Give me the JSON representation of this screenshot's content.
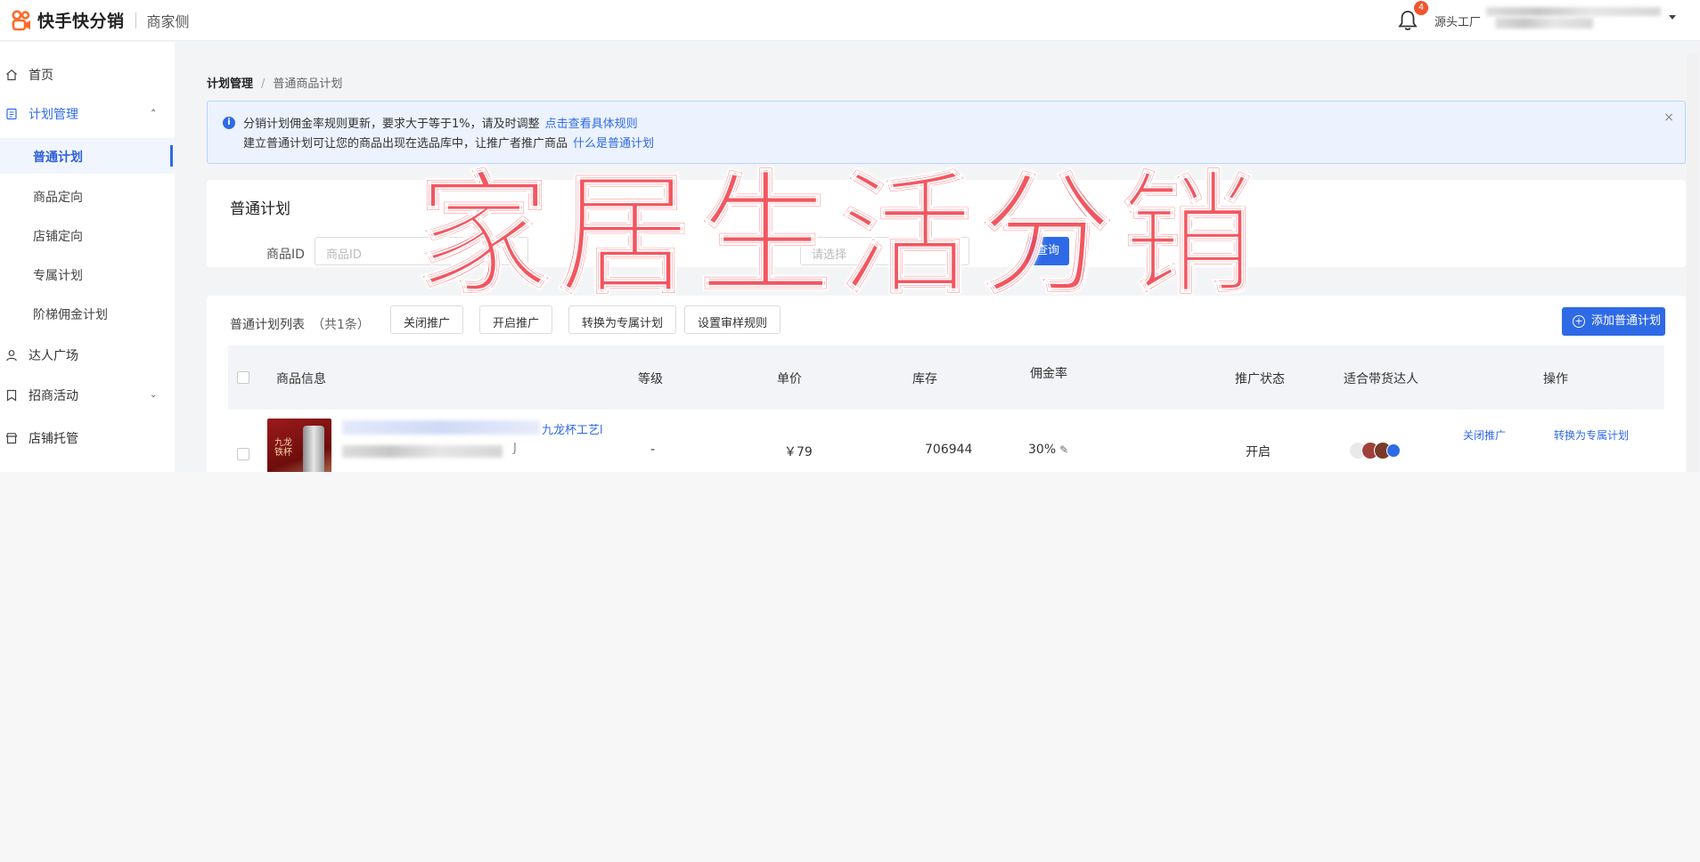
{
  "app": {
    "brand": "快手快分销",
    "subtitle": "商家侧"
  },
  "topbar": {
    "notification_count": "4",
    "user_name": "源头工厂"
  },
  "sidebar": {
    "items": [
      {
        "label": "首页",
        "icon": "home-icon"
      },
      {
        "label": "计划管理",
        "icon": "document-icon",
        "expanded": true
      },
      {
        "label": "达人广场",
        "icon": "user-icon"
      },
      {
        "label": "招商活动",
        "icon": "bookmark-icon",
        "expanded": false
      },
      {
        "label": "店铺托管",
        "icon": "store-icon"
      }
    ],
    "sub_items": [
      {
        "label": "普通计划",
        "active": true
      },
      {
        "label": "商品定向"
      },
      {
        "label": "店铺定向"
      },
      {
        "label": "专属计划"
      },
      {
        "label": "阶梯佣金计划"
      }
    ]
  },
  "breadcrumb": {
    "parent": "计划管理",
    "separator": "/",
    "current": "普通商品计划"
  },
  "alert": {
    "line1": "分销计划佣金率规则更新，要求大于等于1%，请及时调整",
    "line1_link": "点击查看具体规则",
    "line2": "建立普通计划可让您的商品出现在选品库中，让推广者推广商品",
    "line2_link": "什么是普通计划",
    "close": "×"
  },
  "filter": {
    "title": "普通计划",
    "product_id_label": "商品ID",
    "product_id_placeholder": "商品ID",
    "status_placeholder": "请选择",
    "search_button": "查询"
  },
  "list": {
    "title": "普通计划列表",
    "count": "（共1条）",
    "bulk_buttons": [
      "关闭推广",
      "开启推广",
      "转换为专属计划",
      "设置审样规则"
    ],
    "add_button": "添加普通计划",
    "columns": [
      "商品信息",
      "等级",
      "单价",
      "库存",
      "佣金率",
      "推广状态",
      "适合带货达人",
      "操作"
    ],
    "rows": [
      {
        "product_title_suffix": "九龙杯工艺l",
        "product_subtitle_suffix": "J",
        "thumbnail_text": "九龙铁杯",
        "level": "-",
        "price": "￥79",
        "stock": "706944",
        "commission": "30%",
        "status": "开启",
        "actions": [
          "关闭推广",
          "转换为专属计划"
        ]
      }
    ]
  },
  "overlay": {
    "text": "家居生活分销"
  },
  "colors": {
    "primary": "#2f6ae6",
    "badge": "#f2542d",
    "overlay": "#f24b55",
    "alert_bg": "#ecf3fe"
  }
}
